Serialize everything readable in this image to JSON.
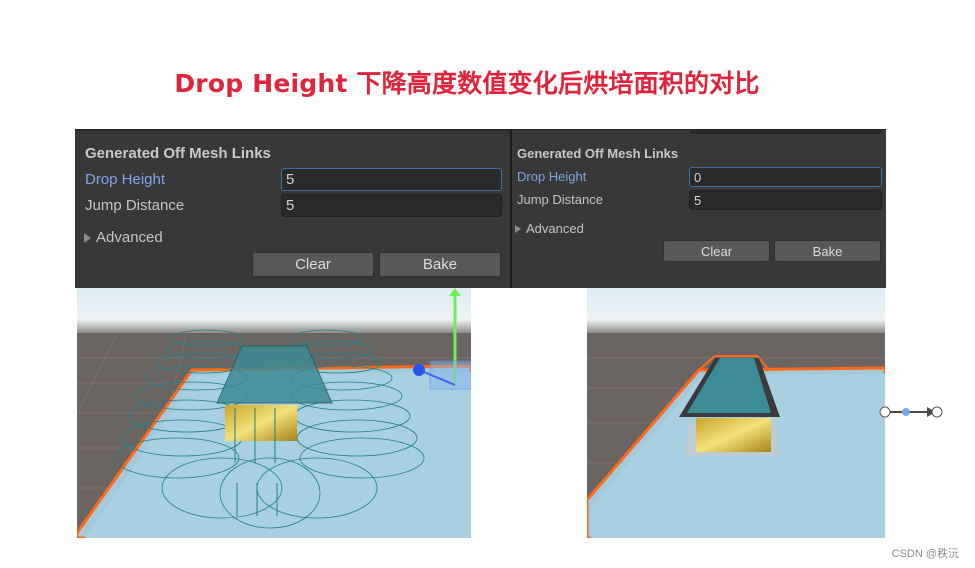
{
  "title": "Drop Height 下降高度数值变化后烘培面积的对比",
  "panels": [
    {
      "id": "left",
      "section_title": "Generated Off Mesh Links",
      "drop_height_label": "Drop Height",
      "drop_height_value": "5",
      "jump_distance_label": "Jump Distance",
      "jump_distance_value": "5",
      "advanced_label": "Advanced",
      "clear_label": "Clear",
      "bake_label": "Bake"
    },
    {
      "id": "right",
      "section_title": "Generated Off Mesh Links",
      "drop_height_label": "Drop Height",
      "drop_height_value": "0",
      "jump_distance_label": "Jump Distance",
      "jump_distance_value": "5",
      "advanced_label": "Advanced",
      "clear_label": "Clear",
      "bake_label": "Bake"
    }
  ],
  "scenes": [
    {
      "id": "left",
      "description": "Scene view with drop height 5: generated off-mesh link circles around platform"
    },
    {
      "id": "right",
      "description": "Scene view with drop height 0: no generated drop links"
    }
  ],
  "colors": {
    "title": "#e0243c",
    "panel_bg": "#383838",
    "focus_label": "#7ba5e6",
    "navmesh_edge": "#ff6a1a",
    "navmesh_fill": "#a8d0e0",
    "link_color": "#1f7f8a"
  },
  "watermark": "CSDN @秩沅"
}
